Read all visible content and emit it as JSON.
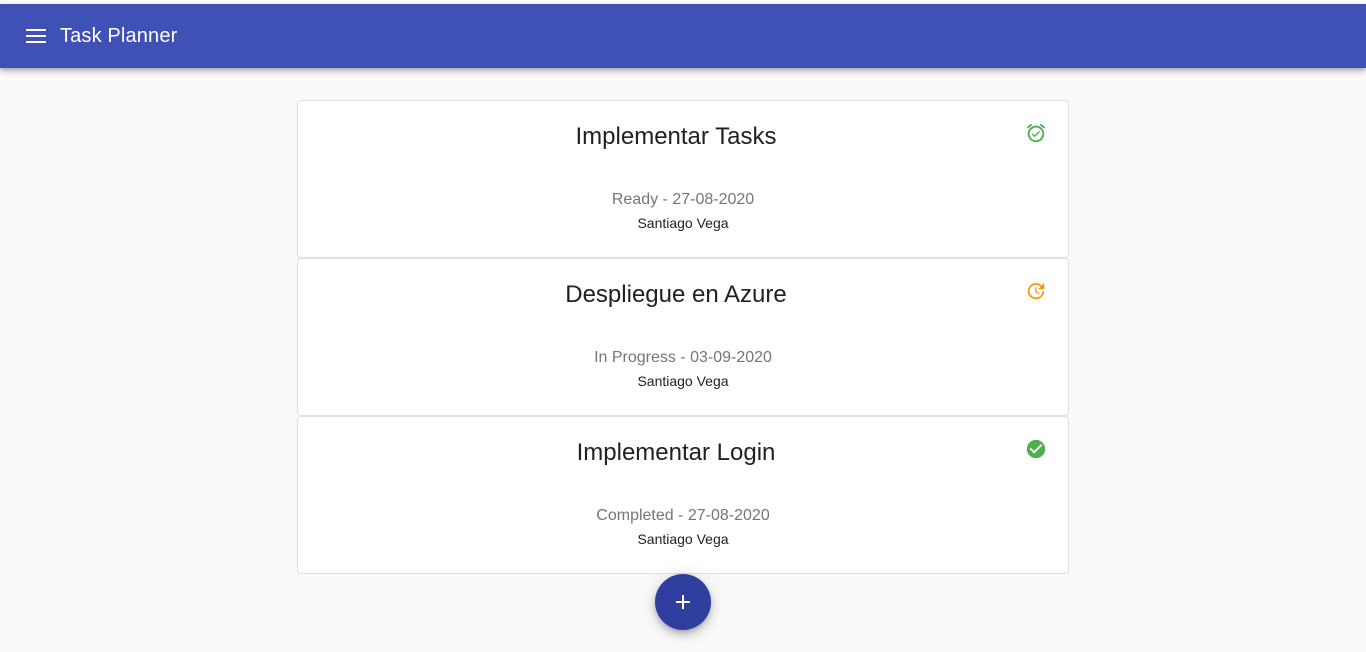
{
  "appbar": {
    "title": "Task Planner",
    "menu_icon": "menu-icon",
    "color": "#3f51b5"
  },
  "tasks": [
    {
      "title": "Implementar Tasks",
      "status_line": "Ready - 27-08-2020",
      "owner": "Santiago Vega",
      "icon": "alarm-on-icon",
      "icon_color": "#4caf50"
    },
    {
      "title": "Despliegue en Azure",
      "status_line": "In Progress - 03-09-2020",
      "owner": "Santiago Vega",
      "icon": "update-icon",
      "icon_color": "#ff9800"
    },
    {
      "title": "Implementar Login",
      "status_line": "Completed - 27-08-2020",
      "owner": "Santiago Vega",
      "icon": "check-circle-icon",
      "icon_color": "#4caf50"
    }
  ],
  "fab": {
    "icon": "add-icon",
    "color": "#303f9f"
  }
}
